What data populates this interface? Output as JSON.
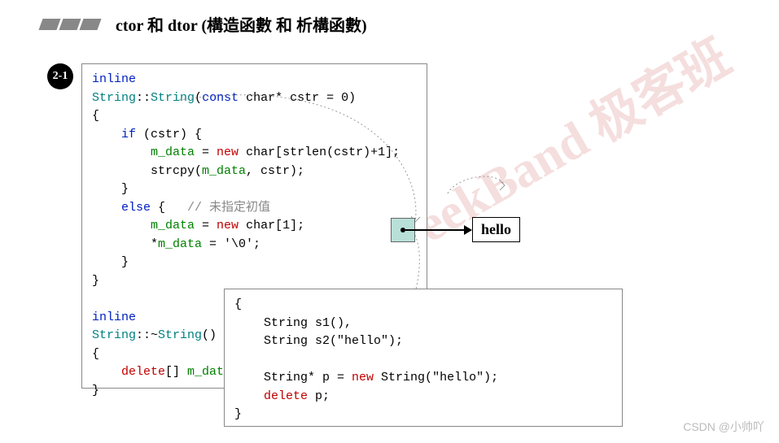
{
  "header": {
    "title": "ctor 和 dtor (構造函數 和 析構函數)"
  },
  "badge": "2-1",
  "code_main": {
    "l1": "inline",
    "l2a": "String",
    "l2b": "::",
    "l2c": "String",
    "l2d": "(",
    "l2e": "const",
    "l2f": " char* cstr = 0)",
    "l3": "{",
    "l4a": "    if",
    "l4b": " (cstr) {",
    "l5a": "        ",
    "l5b": "m_data",
    "l5c": " = ",
    "l5d": "new",
    "l5e": " char[strlen(cstr)+1];",
    "l6a": "        strcpy(",
    "l6b": "m_data",
    "l6c": ", cstr);",
    "l7": "    }",
    "l8a": "    else",
    "l8b": " {   ",
    "l8c": "// 未指定初值",
    "l9a": "        ",
    "l9b": "m_data",
    "l9c": " = ",
    "l9d": "new",
    "l9e": " char[1];",
    "l10a": "        *",
    "l10b": "m_data",
    "l10c": " = '\\0';",
    "l11": "    }",
    "l12": "}",
    "l13": "",
    "l14": "inline",
    "l15a": "String",
    "l15b": "::~",
    "l15c": "String",
    "l15d": "()",
    "l16": "{",
    "l17a": "    ",
    "l17b": "delete",
    "l17c": "[] ",
    "l17d": "m_data",
    "l17e": ";",
    "l18": "}"
  },
  "code_usage": {
    "u1": "{",
    "u2a": "    String s1()",
    "u2b": ",",
    "u3a": "    String s2(",
    "u3b": "\"hello\"",
    "u3c": ");",
    "u4": "",
    "u5a": "    String* p = ",
    "u5b": "new",
    "u5c": " String(",
    "u5d": "\"hello\"",
    "u5e": ");",
    "u6a": "    ",
    "u6b": "delete",
    "u6c": " p;",
    "u7": "}"
  },
  "hello": "hello",
  "watermark_main": "GeekBand 极客班",
  "watermark_footer": "CSDN @小帅吖"
}
